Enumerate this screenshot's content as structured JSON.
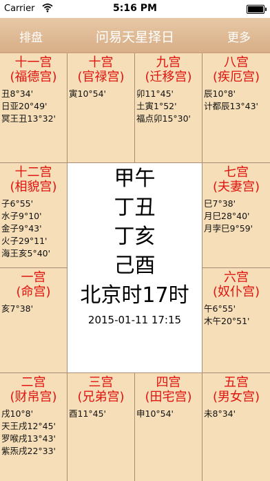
{
  "status": {
    "carrier": "Carrier",
    "time": "5:16 PM"
  },
  "nav": {
    "left": "排盘",
    "title": "问易天星择日",
    "right": "更多"
  },
  "cells": {
    "c11": {
      "name": "十一宫",
      "palace": "(福德宫)",
      "stars": [
        "丑8°34'",
        "日亚20°49'",
        "冥王丑13°32'"
      ]
    },
    "c10": {
      "name": "十宫",
      "palace": "(官禄宫)",
      "stars": [
        "寅10°54'"
      ]
    },
    "c9": {
      "name": "九宫",
      "palace": "(迁移宫)",
      "stars": [
        "卯11°45'",
        "土寅1°52'",
        "福点卯15°30'"
      ]
    },
    "c8": {
      "name": "八宫",
      "palace": "(疾厄宫)",
      "stars": [
        "辰10°8'",
        "计都辰13°43'"
      ]
    },
    "c12": {
      "name": "十二宫",
      "palace": "(相貌宫)",
      "stars": [
        "子6°55'",
        "水子9°10'",
        "金子9°43'",
        "火子29°11'",
        "海王亥5°40'"
      ]
    },
    "c7": {
      "name": "七宫",
      "palace": "(夫妻宫)",
      "stars": [
        "巳7°38'",
        "月巳28°40'",
        "月孛巳9°59'"
      ]
    },
    "c1": {
      "name": "一宫",
      "palace": "(命宫)",
      "stars": [
        "亥7°38'"
      ]
    },
    "c6": {
      "name": "六宫",
      "palace": "(奴仆宫)",
      "stars": [
        "午6°55'",
        "木午20°51'"
      ]
    },
    "c2": {
      "name": "二宫",
      "palace": "(财帛宫)",
      "stars": [
        "戌10°8'",
        "天王戌12°45'",
        "罗喉戌13°43'",
        "紫炁戌22°33'"
      ]
    },
    "c3": {
      "name": "三宫",
      "palace": "(兄弟宫)",
      "stars": [
        "酉11°45'"
      ]
    },
    "c4": {
      "name": "四宫",
      "palace": "(田宅宫)",
      "stars": [
        "申10°54'"
      ]
    },
    "c5": {
      "name": "五宫",
      "palace": "(男女宫)",
      "stars": [
        "未8°34'"
      ]
    }
  },
  "center": {
    "pillars": [
      "甲午",
      "丁丑",
      "丁亥",
      "己酉"
    ],
    "hour": "北京时17时",
    "datetime": "2015-01-11 17:15"
  },
  "colors": {
    "palace_text": "#e0140f",
    "cell_bg": "#f6deb8",
    "nav_bg": "#dcb48c"
  }
}
